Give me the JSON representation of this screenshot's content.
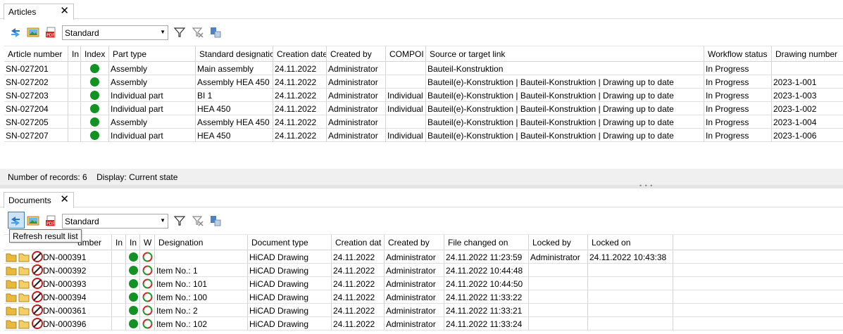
{
  "articles": {
    "tab_label": "Articles",
    "combo_value": "Standard",
    "columns": [
      "Article number",
      "In",
      "Index",
      "Part type",
      "Standard designatic",
      "Creation date",
      "Created by",
      "COMPOI",
      "Source or target link",
      "Workflow status",
      "Drawing number"
    ],
    "rows": [
      {
        "article_number": "SN-027201",
        "part_type": "Assembly",
        "designation": "Main assembly",
        "creation_date": "24.11.2022",
        "created_by": "Administrator",
        "component": "",
        "link": "Bauteil-Konstruktion",
        "status": "In Progress",
        "drawing_number": ""
      },
      {
        "article_number": "SN-027202",
        "part_type": "Assembly",
        "designation": "Assembly HEA 450",
        "creation_date": "24.11.2022",
        "created_by": "Administrator",
        "component": "",
        "link": "Bauteil(e)-Konstruktion | Bauteil-Konstruktion | Drawing up to date",
        "status": "In Progress",
        "drawing_number": "2023-1-001"
      },
      {
        "article_number": "SN-027203",
        "part_type": "Individual part",
        "designation": "BI 1",
        "creation_date": "24.11.2022",
        "created_by": "Administrator",
        "component": "Individual",
        "link": "Bauteil(e)-Konstruktion | Bauteil-Konstruktion | Drawing up to date",
        "status": "In Progress",
        "drawing_number": "2023-1-003"
      },
      {
        "article_number": "SN-027204",
        "part_type": "Individual part",
        "designation": "HEA 450",
        "creation_date": "24.11.2022",
        "created_by": "Administrator",
        "component": "Individual",
        "link": "Bauteil(e)-Konstruktion | Bauteil-Konstruktion | Drawing up to date",
        "status": "In Progress",
        "drawing_number": "2023-1-002"
      },
      {
        "article_number": "SN-027205",
        "part_type": "Assembly",
        "designation": "Assembly HEA 450",
        "creation_date": "24.11.2022",
        "created_by": "Administrator",
        "component": "",
        "link": "Bauteil(e)-Konstruktion | Bauteil-Konstruktion | Drawing up to date",
        "status": "In Progress",
        "drawing_number": "2023-1-004"
      },
      {
        "article_number": "SN-027207",
        "part_type": "Individual part",
        "designation": "HEA 450",
        "creation_date": "24.11.2022",
        "created_by": "Administrator",
        "component": "Individual",
        "link": "Bauteil(e)-Konstruktion | Bauteil-Konstruktion | Drawing up to date",
        "status": "In Progress",
        "drawing_number": "2023-1-006"
      }
    ],
    "status_records": "Number of records: 6",
    "status_display": "Display: Current state"
  },
  "documents": {
    "tab_label": "Documents",
    "combo_value": "Standard",
    "tooltip": "Refresh result list",
    "columns": [
      "umber",
      "In",
      "In",
      "W",
      "Designation",
      "Document type",
      "Creation dat",
      "Created by",
      "File changed on",
      "Locked by",
      "Locked on"
    ],
    "rows": [
      {
        "number": "DN-000391",
        "designation": "",
        "doc_type": "HiCAD Drawing",
        "creation_date": "24.11.2022",
        "created_by": "Administrator",
        "file_changed": "24.11.2022 11:23:59",
        "locked_by": "Administrator",
        "locked_on": "24.11.2022 10:43:38"
      },
      {
        "number": "DN-000392",
        "designation": "Item No.: 1",
        "doc_type": "HiCAD Drawing",
        "creation_date": "24.11.2022",
        "created_by": "Administrator",
        "file_changed": "24.11.2022 10:44:48",
        "locked_by": "",
        "locked_on": ""
      },
      {
        "number": "DN-000393",
        "designation": "Item No.: 101",
        "doc_type": "HiCAD Drawing",
        "creation_date": "24.11.2022",
        "created_by": "Administrator",
        "file_changed": "24.11.2022 10:44:50",
        "locked_by": "",
        "locked_on": ""
      },
      {
        "number": "DN-000394",
        "designation": "Item No.: 100",
        "doc_type": "HiCAD Drawing",
        "creation_date": "24.11.2022",
        "created_by": "Administrator",
        "file_changed": "24.11.2022 11:33:22",
        "locked_by": "",
        "locked_on": ""
      },
      {
        "number": "DN-000361",
        "designation": "Item No.: 2",
        "doc_type": "HiCAD Drawing",
        "creation_date": "24.11.2022",
        "created_by": "Administrator",
        "file_changed": "24.11.2022 11:33:21",
        "locked_by": "",
        "locked_on": ""
      },
      {
        "number": "DN-000396",
        "designation": "Item No.: 102",
        "doc_type": "HiCAD Drawing",
        "creation_date": "24.11.2022",
        "created_by": "Administrator",
        "file_changed": "24.11.2022 11:33:24",
        "locked_by": "",
        "locked_on": ""
      }
    ]
  },
  "icons": {
    "refresh": "refresh-icon",
    "preview": "image-preview-icon",
    "pdf": "pdf-export-icon",
    "filter": "filter-icon",
    "clear_filter": "clear-filter-icon",
    "columns": "column-settings-icon",
    "status_ok": "status-green-icon",
    "folder": "folder-icon",
    "hicad": "hicad-drawing-icon",
    "workflow": "workflow-cycle-icon"
  },
  "colors": {
    "status_green": "#129222",
    "selection": "#cce4f7"
  }
}
